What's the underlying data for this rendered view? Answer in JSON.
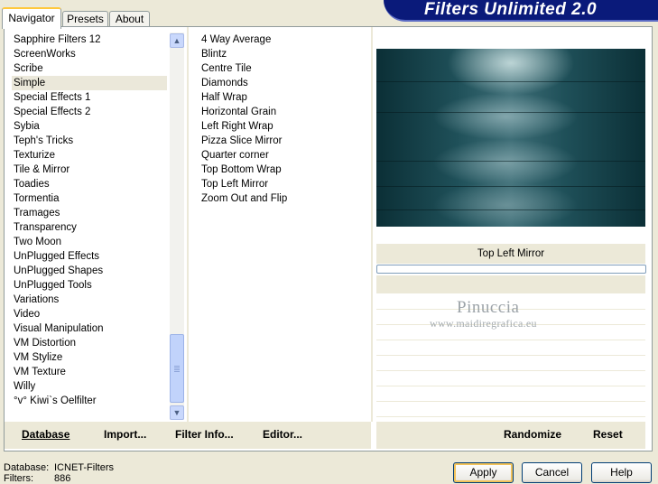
{
  "tabs": [
    {
      "label": "Navigator"
    },
    {
      "label": "Presets"
    },
    {
      "label": "About"
    }
  ],
  "title": "Filters Unlimited 2.0",
  "categories": [
    "Sapphire Filters 12",
    "ScreenWorks",
    "Scribe",
    "Simple",
    "Special Effects 1",
    "Special Effects 2",
    "Sybia",
    "Teph's Tricks",
    "Texturize",
    "Tile & Mirror",
    "Toadies",
    "Tormentia",
    "Tramages",
    "Transparency",
    "Two Moon",
    "UnPlugged Effects",
    "UnPlugged Shapes",
    "UnPlugged Tools",
    "Variations",
    "Video",
    "Visual Manipulation",
    "VM Distortion",
    "VM Stylize",
    "VM Texture",
    "Willy",
    "°v° Kiwi`s Oelfilter"
  ],
  "selected_category": "Simple",
  "filters": [
    "4 Way Average",
    "Blintz",
    "Centre Tile",
    "Diamonds",
    "Half Wrap",
    "Horizontal Grain",
    "Left Right Wrap",
    "Pizza Slice Mirror",
    "Quarter corner",
    "Top Bottom Wrap",
    "Top Left Mirror",
    "Zoom Out and Flip"
  ],
  "selected_filter": "Top Left Mirror",
  "preview": {
    "filter_name": "Top Left Mirror",
    "progress": 0
  },
  "watermark": {
    "line1": "Pinuccia",
    "line2": "www.maidiregrafica.eu"
  },
  "toolbar": {
    "database": "Database",
    "import": "Import...",
    "filter_info": "Filter Info...",
    "editor": "Editor...",
    "randomize": "Randomize",
    "reset": "Reset"
  },
  "status": {
    "database_label": "Database:",
    "database_value": "ICNET-Filters",
    "filters_label": "Filters:",
    "filters_value": "886"
  },
  "buttons": {
    "apply": "Apply",
    "cancel": "Cancel",
    "help": "Help"
  },
  "colors": {
    "selection": "#316AC5",
    "banner": "#0A1A7A",
    "dialog_bg": "#ECE9D8"
  }
}
